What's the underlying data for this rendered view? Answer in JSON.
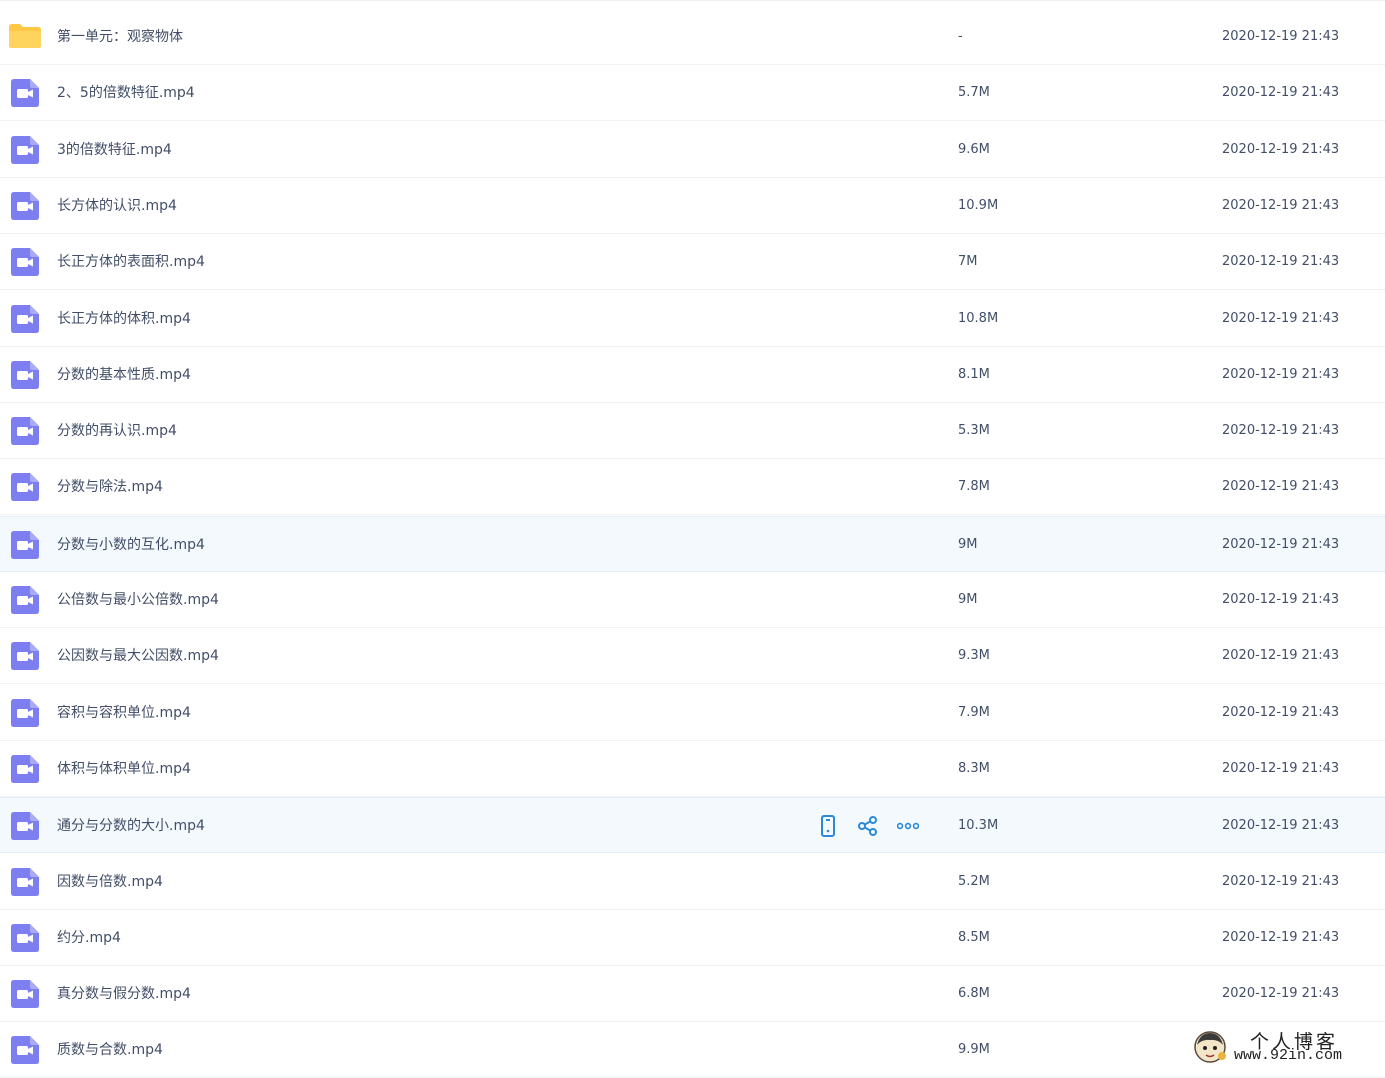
{
  "colors": {
    "video_icon": "#7d7ff0",
    "folder_icon": "#ffc847",
    "action_icon": "#2b8ad8",
    "text": "#424e67",
    "hover_row": "#f4f9fe"
  },
  "files": [
    {
      "name": "第一单元：观察物体",
      "size": "-",
      "date": "2020-12-19 21:43",
      "type": "folder"
    },
    {
      "name": "2、5的倍数特征.mp4",
      "size": "5.7M",
      "date": "2020-12-19 21:43",
      "type": "video"
    },
    {
      "name": "3的倍数特征.mp4",
      "size": "9.6M",
      "date": "2020-12-19 21:43",
      "type": "video"
    },
    {
      "name": "长方体的认识.mp4",
      "size": "10.9M",
      "date": "2020-12-19 21:43",
      "type": "video"
    },
    {
      "name": "长正方体的表面积.mp4",
      "size": "7M",
      "date": "2020-12-19 21:43",
      "type": "video"
    },
    {
      "name": "长正方体的体积.mp4",
      "size": "10.8M",
      "date": "2020-12-19 21:43",
      "type": "video"
    },
    {
      "name": "分数的基本性质.mp4",
      "size": "8.1M",
      "date": "2020-12-19 21:43",
      "type": "video"
    },
    {
      "name": "分数的再认识.mp4",
      "size": "5.3M",
      "date": "2020-12-19 21:43",
      "type": "video"
    },
    {
      "name": "分数与除法.mp4",
      "size": "7.8M",
      "date": "2020-12-19 21:43",
      "type": "video"
    },
    {
      "name": "分数与小数的互化.mp4",
      "size": "9M",
      "date": "2020-12-19 21:43",
      "type": "video",
      "highlighted": true
    },
    {
      "name": "公倍数与最小公倍数.mp4",
      "size": "9M",
      "date": "2020-12-19 21:43",
      "type": "video"
    },
    {
      "name": "公因数与最大公因数.mp4",
      "size": "9.3M",
      "date": "2020-12-19 21:43",
      "type": "video"
    },
    {
      "name": "容积与容积单位.mp4",
      "size": "7.9M",
      "date": "2020-12-19 21:43",
      "type": "video"
    },
    {
      "name": "体积与体积单位.mp4",
      "size": "8.3M",
      "date": "2020-12-19 21:43",
      "type": "video"
    },
    {
      "name": "通分与分数的大小.mp4",
      "size": "10.3M",
      "date": "2020-12-19 21:43",
      "type": "video",
      "highlighted": true,
      "show_actions": true
    },
    {
      "name": "因数与倍数.mp4",
      "size": "5.2M",
      "date": "2020-12-19 21:43",
      "type": "video"
    },
    {
      "name": "约分.mp4",
      "size": "8.5M",
      "date": "2020-12-19 21:43",
      "type": "video"
    },
    {
      "name": "真分数与假分数.mp4",
      "size": "6.8M",
      "date": "2020-12-19 21:43",
      "type": "video"
    },
    {
      "name": "质数与合数.mp4",
      "size": "9.9M",
      "date": "",
      "type": "video"
    }
  ],
  "row_actions": [
    {
      "icon": "phone-icon"
    },
    {
      "icon": "share-icon"
    },
    {
      "icon": "more-icon"
    }
  ],
  "watermark": {
    "title": "个人博客",
    "url": "www.92in.com"
  }
}
